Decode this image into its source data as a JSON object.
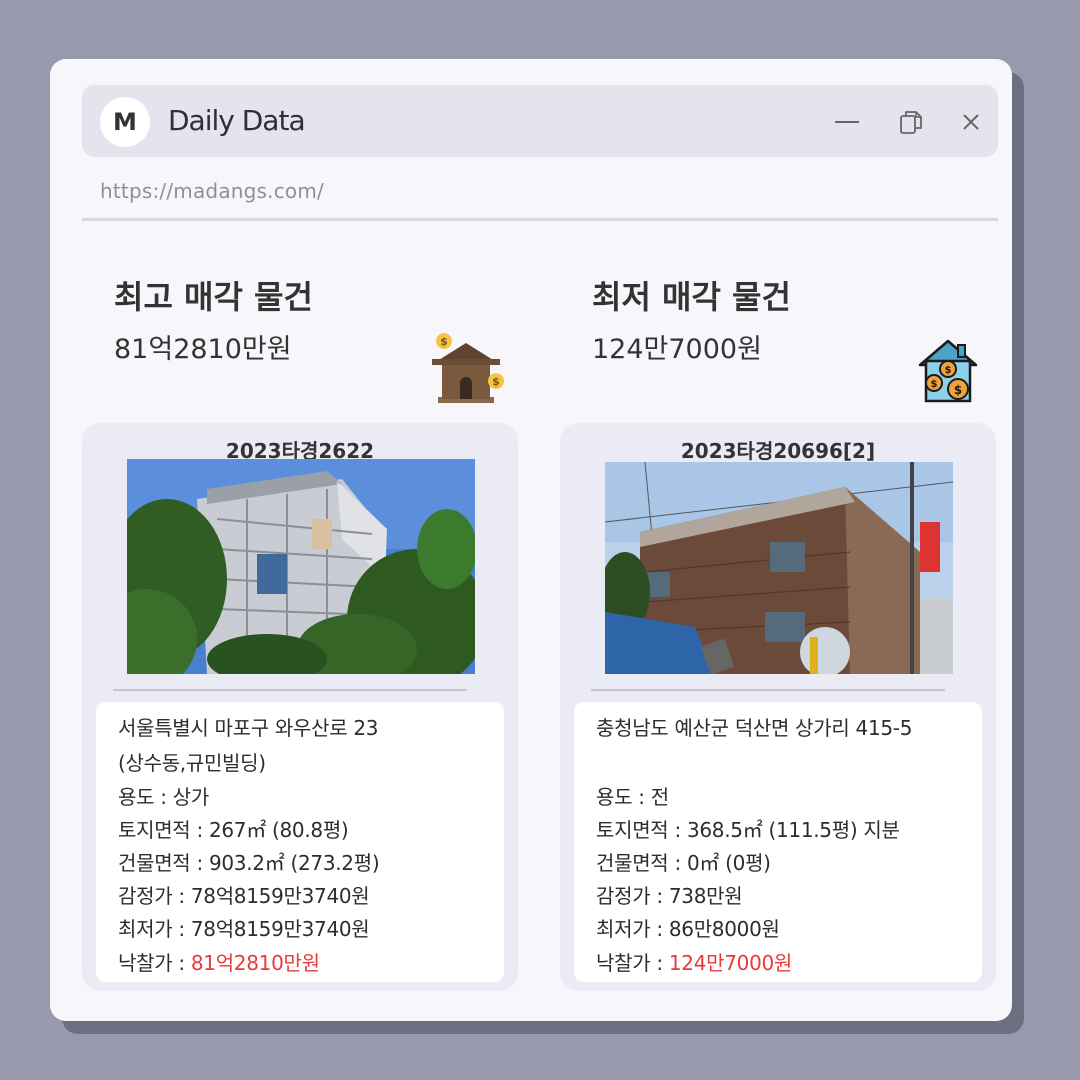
{
  "window": {
    "logo_letter": "M",
    "title": "Daily Data",
    "url": "https://madangs.com/"
  },
  "highest": {
    "heading": "최고 매각 물건",
    "amount": "81억2810만원",
    "case_no": "2023타경2622",
    "address_line1": "서울특별시 마포구 와우산로 23",
    "address_line2": "(상수동,규민빌딩)",
    "usage": "용도 : 상가",
    "land_area": "토지면적 : 267㎡ (80.8평)",
    "building_area": "건물면적 : 903.2㎡ (273.2평)",
    "appraisal": "감정가 : 78억8159만3740원",
    "minimum": "최저가 : 78억8159만3740원",
    "winning_label": "낙찰가 : ",
    "winning_value": "81억2810만원"
  },
  "lowest": {
    "heading": "최저 매각 물건",
    "amount": "124만7000원",
    "case_no": "2023타경20696[2]",
    "address_line1": "충청남도 예산군 덕산면 상가리 415-5",
    "address_line2": "",
    "usage": "용도 : 전",
    "land_area": "토지면적 : 368.5㎡ (111.5평) 지분",
    "building_area": "건물면적 : 0㎡ (0평)",
    "appraisal": "감정가 :  738만원",
    "minimum": "최저가 : 86만8000원",
    "winning_label": "낙찰가 : ",
    "winning_value": "124만7000원"
  },
  "colors": {
    "background": "#9899ad",
    "window": "#f7f7fb",
    "titlebar": "#e3e4ee",
    "card": "#ebebf6",
    "highlight_price": "#e83a3a"
  },
  "icons": {
    "minimize": "minimize-icon",
    "restore": "restore-icon",
    "close": "close-icon",
    "expensive_house": "house-money-icon",
    "cheap_house": "house-coins-icon"
  }
}
